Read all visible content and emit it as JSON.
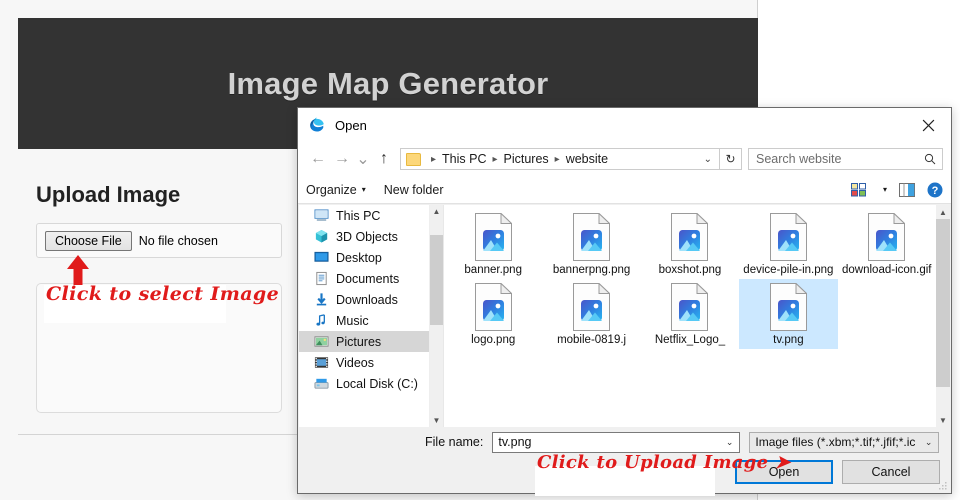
{
  "page": {
    "hero_title": "Image Map Generator",
    "upload_heading": "Upload Image",
    "choose_file_label": "Choose File",
    "no_file_text": "No file chosen",
    "annotation_select": "Click to select Image",
    "accent_red": "#e01b1b",
    "hero_bg": "#333333",
    "hero_text_color": "#d2d2d2"
  },
  "dialog": {
    "title": "Open",
    "title_icon": "edge-logo-icon",
    "close_label": "✕",
    "nav": {
      "back_label": "←",
      "forward_label": "→",
      "recent_label": "⌄",
      "up_label": "↑",
      "refresh_label": "↻",
      "breadcrumb": [
        "This PC",
        "Pictures",
        "website"
      ],
      "breadcrumb_caret": "⌄",
      "search_placeholder": "Search website"
    },
    "toolbar": {
      "organize_label": "Organize",
      "organize_caret": "▾",
      "new_folder_label": "New folder",
      "view_caret": "▾",
      "view_icon": "view-options-icon",
      "preview_icon": "preview-pane-icon",
      "help_icon": "help-icon"
    },
    "sidebar": {
      "items": [
        {
          "label": "This PC",
          "icon": "this-pc-icon",
          "selected": false
        },
        {
          "label": "3D Objects",
          "icon": "3d-objects-icon",
          "selected": false
        },
        {
          "label": "Desktop",
          "icon": "desktop-icon",
          "selected": false
        },
        {
          "label": "Documents",
          "icon": "documents-icon",
          "selected": false
        },
        {
          "label": "Downloads",
          "icon": "downloads-icon",
          "selected": false
        },
        {
          "label": "Music",
          "icon": "music-icon",
          "selected": false
        },
        {
          "label": "Pictures",
          "icon": "pictures-icon",
          "selected": true
        },
        {
          "label": "Videos",
          "icon": "videos-icon",
          "selected": false
        },
        {
          "label": "Local Disk (C:)",
          "icon": "local-disk-icon",
          "selected": false
        }
      ]
    },
    "files": [
      {
        "name": "banner.png",
        "icon": "image-file-icon",
        "selected": false
      },
      {
        "name": "bannerpng.png",
        "icon": "image-file-icon",
        "selected": false
      },
      {
        "name": "boxshot.png",
        "icon": "image-file-icon",
        "selected": false
      },
      {
        "name": "device-pile-in.png",
        "icon": "image-file-icon",
        "selected": false
      },
      {
        "name": "download-icon.gif",
        "icon": "image-file-icon",
        "selected": false
      },
      {
        "name": "logo.png",
        "icon": "image-file-icon",
        "selected": false
      },
      {
        "name": "mobile-0819.j",
        "icon": "image-file-icon",
        "selected": false
      },
      {
        "name": "Netflix_Logo_",
        "icon": "image-file-icon",
        "selected": false
      },
      {
        "name": "tv.png",
        "icon": "image-file-icon",
        "selected": true
      }
    ],
    "bottom": {
      "filename_label": "File name:",
      "filename_value": "tv.png",
      "filename_caret": "⌄",
      "filetype_value": "Image files (*.xbm;*.tif;*.jfif;*.ic",
      "filetype_caret": "⌄",
      "open_label": "Open",
      "cancel_label": "Cancel",
      "annotation_upload": "Click to Upload Image ➤"
    }
  }
}
